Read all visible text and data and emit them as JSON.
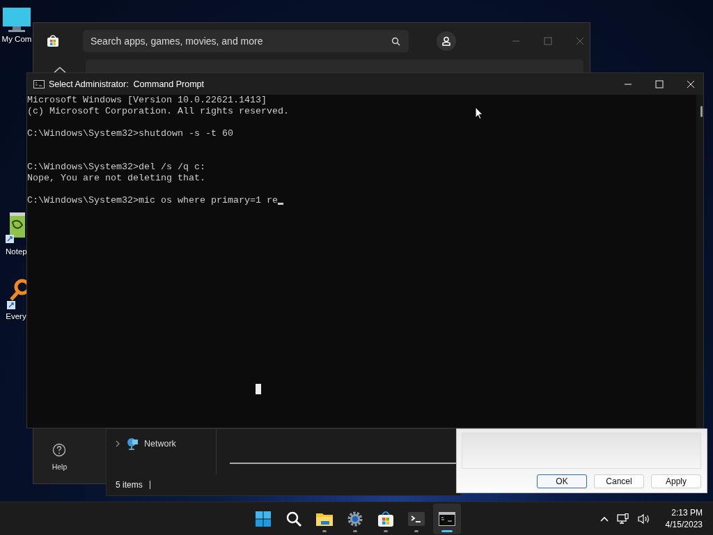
{
  "desktop_icons": [
    {
      "kind": "computer",
      "label": "My Com"
    },
    {
      "kind": "notepad",
      "label": "Notep"
    },
    {
      "kind": "search-tool",
      "label": "Every"
    }
  ],
  "store_window": {
    "search": {
      "placeholder": "Search apps, games, movies, and more"
    },
    "nav": [
      {
        "label": "Help"
      }
    ]
  },
  "explorer_window": {
    "nav_items": [
      {
        "label": "Network",
        "expanded": false
      }
    ],
    "status_bar": {
      "item_count": "5 items"
    }
  },
  "dialog": {
    "buttons": [
      {
        "label": "OK",
        "default": true
      },
      {
        "label": "Cancel",
        "default": false
      },
      {
        "label": "Apply",
        "default": false
      }
    ]
  },
  "cmd_window": {
    "title": "Select Administrator:  Command Prompt",
    "blocks": [
      [
        "Microsoft Windows [Version 10.0.22621.1413]",
        "(c) Microsoft Corporation. All rights reserved."
      ],
      [
        "C:\\Windows\\System32>shutdown -s -t 60"
      ],
      [
        "C:\\Windows\\System32>del /s /q c:",
        "Nope, You are not deleting that."
      ],
      [
        "C:\\Windows\\System32>mic os where primary=1 re"
      ]
    ]
  },
  "taskbar": {
    "apps": [
      {
        "kind": "start",
        "running": false,
        "selected": false
      },
      {
        "kind": "search",
        "running": false,
        "selected": false
      },
      {
        "kind": "folder",
        "running": true,
        "selected": false
      },
      {
        "kind": "gear",
        "running": true,
        "selected": false
      },
      {
        "kind": "store",
        "running": true,
        "selected": false
      },
      {
        "kind": "terminal",
        "running": true,
        "selected": false
      },
      {
        "kind": "console",
        "running": true,
        "selected": true
      }
    ],
    "tray": {
      "time": "2:13 PM",
      "date": "4/15/2023"
    }
  }
}
